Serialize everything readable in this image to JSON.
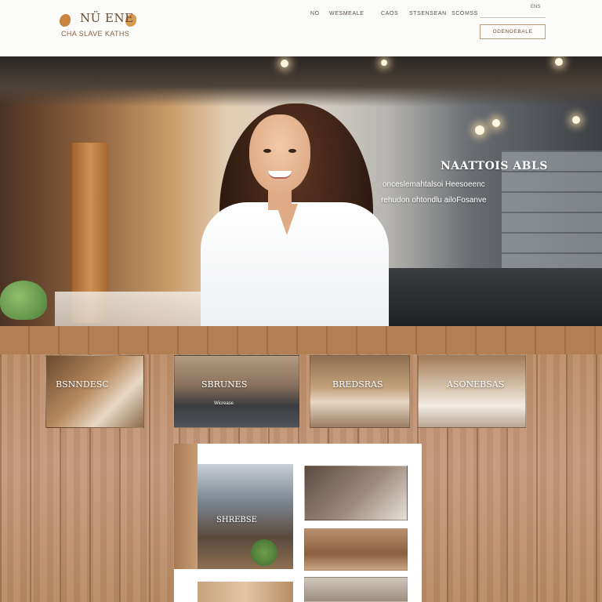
{
  "header": {
    "logo": {
      "title": "NÜ ENE",
      "subtitle": "CHA SLAVE KATHS"
    },
    "nav": [
      "NO",
      "WESMEALE",
      "CAOS",
      "STSENSEAN",
      "SCOMSS"
    ],
    "util_link": "ENS",
    "book_button": "ODENOEBALE"
  },
  "hero": {
    "title": "NAATTOIS ABLS",
    "line_1": "onceslemahtalsoi Heesoeenc",
    "line_2": "rehudon ohtondlu ailoFosanve"
  },
  "cards": [
    {
      "label": "BSNNDESC",
      "sub": ""
    },
    {
      "label": "SBRUNES",
      "sub": "Wicrease"
    },
    {
      "label": "BREDSRAS",
      "sub": ""
    },
    {
      "label": "ASONEBSAS",
      "sub": ""
    }
  ],
  "panel": {
    "photo_label": "SHREBSE"
  },
  "colors": {
    "accent": "#c9843f",
    "header_bg": "#fbfbfa",
    "button_border": "#b89a7c",
    "wood": "#c6987a"
  }
}
